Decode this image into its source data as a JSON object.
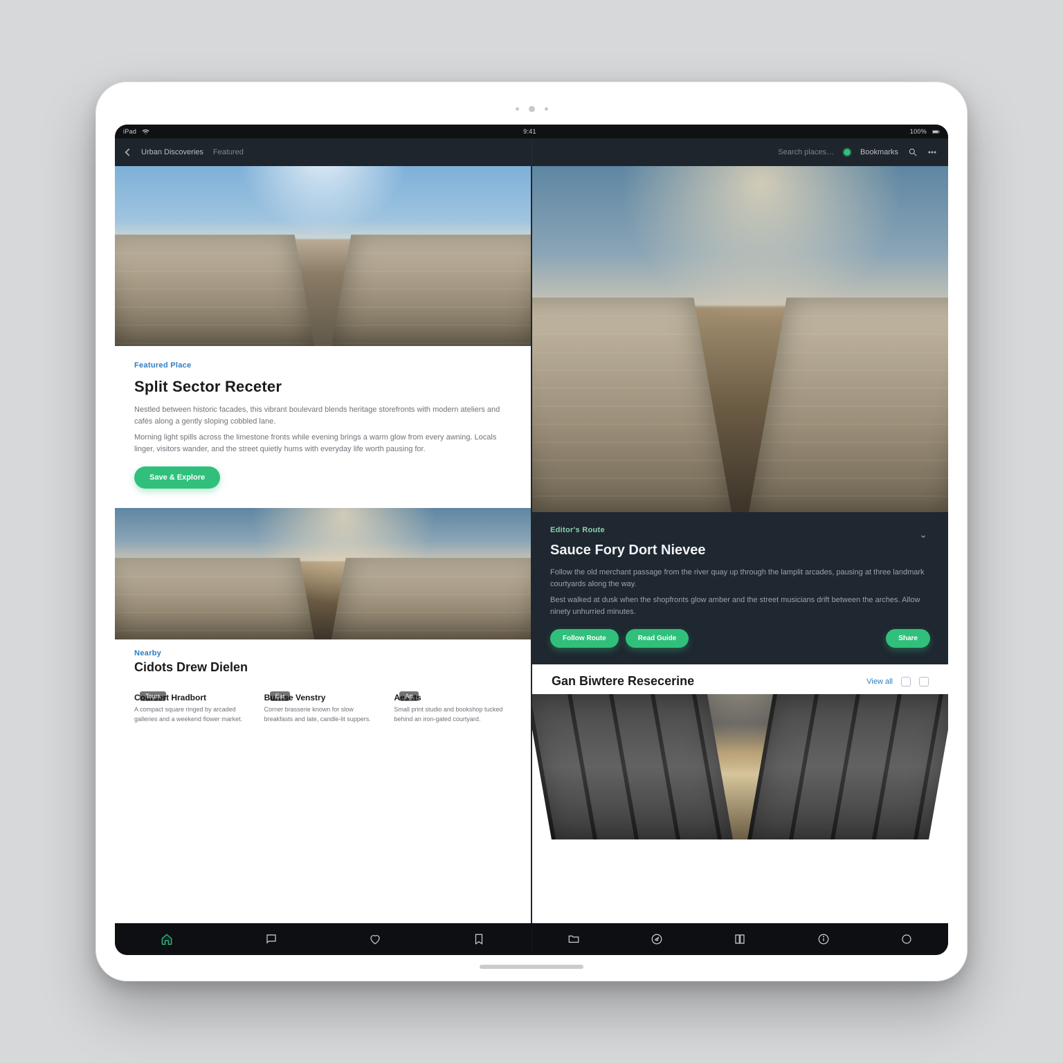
{
  "status": {
    "time": "9:41",
    "carrier": "iPad",
    "right": "100%"
  },
  "topbar": {
    "left_title": "Urban Discoveries",
    "left_crumb": "Featured",
    "center": "Search places…",
    "right_label": "Bookmarks"
  },
  "left": {
    "article1": {
      "eyebrow": "Featured Place",
      "headline": "Split Sector Receter",
      "body": [
        "Nestled between historic facades, this vibrant boulevard blends heritage storefronts with modern ateliers and cafés along a gently sloping cobbled lane.",
        "Morning light spills across the limestone fronts while evening brings a warm glow from every awning. Locals linger, visitors wander, and the street quietly hums with everyday life worth pausing for."
      ],
      "cta": "Save & Explore"
    },
    "section2_eyebrow": "Nearby",
    "section2_title": "Cidots Drew Dielen",
    "cards": [
      {
        "tag": "Tours",
        "title": "Coursert Hradbort",
        "sub": "A compact square ringed by arcaded galleries and a weekend flower market."
      },
      {
        "tag": "Eat",
        "title": "Burrise Venstry",
        "sub": "Corner brasserie known for slow breakfasts and late, candle-lit suppers."
      },
      {
        "tag": "Art",
        "title": "Aes Its",
        "sub": "Small print studio and bookshop tucked behind an iron-gated courtyard."
      }
    ]
  },
  "right": {
    "panel": {
      "eyebrow": "Editor's Route",
      "title": "Sauce Fory Dort Nievee",
      "body": [
        "Follow the old merchant passage from the river quay up through the lamplit arcades, pausing at three landmark courtyards along the way.",
        "Best walked at dusk when the shopfronts glow amber and the street musicians drift between the arches. Allow ninety unhurried minutes."
      ],
      "btn1": "Follow Route",
      "btn2": "Read Guide",
      "btn3": "Share"
    },
    "section2_title": "Gan Biwtere Resecerine",
    "section2_link": "View all"
  },
  "nav": {
    "left": [
      "home",
      "chat",
      "heart",
      "bookmark"
    ],
    "right": [
      "folder",
      "compass",
      "book",
      "info",
      "circle"
    ]
  },
  "colors": {
    "accent": "#30c07b",
    "link": "#2c7dc0",
    "panel": "#1f2730"
  }
}
